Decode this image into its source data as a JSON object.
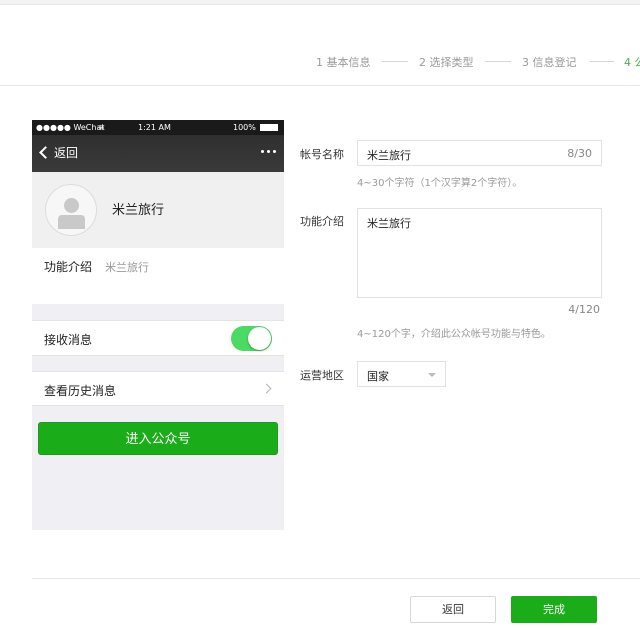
{
  "steps": [
    {
      "label": "1 基本信息",
      "active": false
    },
    {
      "label": "2 选择类型",
      "active": false
    },
    {
      "label": "3 信息登记",
      "active": false
    },
    {
      "label": "4 公",
      "active": true
    }
  ],
  "phone": {
    "status": {
      "carrier": "●●●●● WeChat",
      "time": "1:21 AM",
      "battery": "100%"
    },
    "nav": {
      "back_label": "返回"
    },
    "account_name": "米兰旅行",
    "intro_label": "功能介绍",
    "intro_value": "米兰旅行",
    "receive_label": "接收消息",
    "receive_enabled": true,
    "history_label": "查看历史消息",
    "enter_button": "进入公众号"
  },
  "form": {
    "name_label": "帐号名称",
    "name_value": "米兰旅行",
    "name_count": "8/30",
    "name_hint": "4~30个字符（1个汉字算2个字符）。",
    "intro_label": "功能介绍",
    "intro_value": "米兰旅行",
    "intro_count": "4/120",
    "intro_hint": "4~120个字，介绍此公众帐号功能与特色。",
    "region_label": "运营地区",
    "region_value": "国家"
  },
  "footer": {
    "back_button": "返回",
    "done_button": "完成"
  },
  "colors": {
    "accent": "#1aad19",
    "step_active": "#44b549",
    "toggle_on": "#4cd964"
  }
}
